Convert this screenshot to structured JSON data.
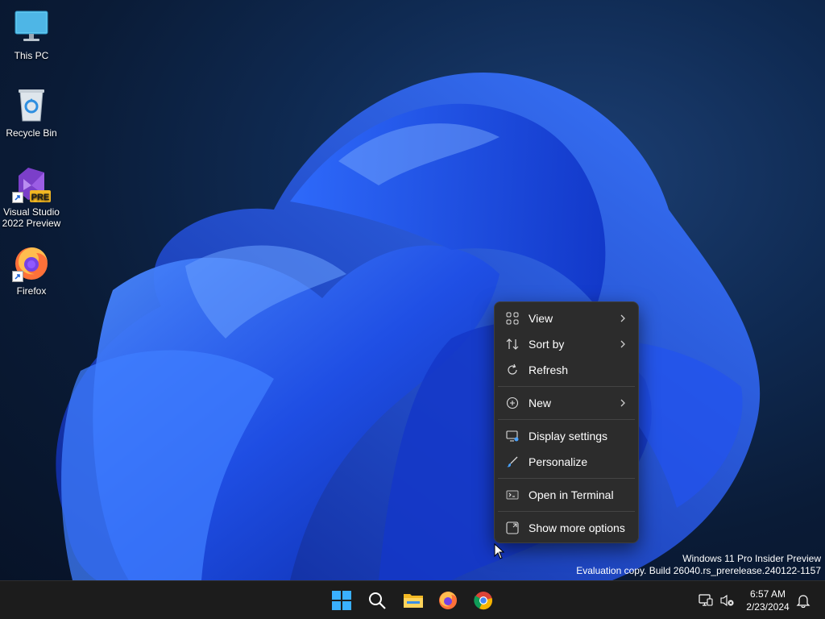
{
  "desktop": {
    "icons": [
      {
        "label_line1": "This PC",
        "label_line2": "",
        "icon": "monitor-icon"
      },
      {
        "label_line1": "Recycle Bin",
        "label_line2": "",
        "icon": "recycle-bin-icon"
      },
      {
        "label_line1": "Visual Studio",
        "label_line2": "2022 Preview",
        "icon": "visual-studio-icon",
        "badge": "PRE"
      },
      {
        "label_line1": "Firefox",
        "label_line2": "",
        "icon": "firefox-icon"
      }
    ]
  },
  "context_menu": {
    "items": [
      {
        "label": "View",
        "icon": "grid-icon",
        "submenu": true
      },
      {
        "label": "Sort by",
        "icon": "sort-icon",
        "submenu": true
      },
      {
        "label": "Refresh",
        "icon": "refresh-icon",
        "submenu": false
      },
      {
        "label": "New",
        "icon": "plus-circle-icon",
        "submenu": true
      },
      {
        "label": "Display settings",
        "icon": "display-settings-icon",
        "submenu": false
      },
      {
        "label": "Personalize",
        "icon": "brush-icon",
        "submenu": false
      },
      {
        "label": "Open in Terminal",
        "icon": "terminal-icon",
        "submenu": false
      },
      {
        "label": "Show more options",
        "icon": "expand-icon",
        "submenu": false
      }
    ]
  },
  "watermark": {
    "line1": "Windows 11 Pro Insider Preview",
    "line2": "Evaluation copy. Build 26040.rs_prerelease.240122-1157"
  },
  "taskbar": {
    "apps": [
      "start-icon",
      "search-icon",
      "file-explorer-icon",
      "firefox-icon",
      "chrome-icon"
    ],
    "clock": {
      "time": "6:57 AM",
      "date": "2/23/2024"
    }
  },
  "colors": {
    "accent": "#1e5bff",
    "menu_bg": "#2c2c2c",
    "taskbar_bg": "#1c1c1c"
  }
}
